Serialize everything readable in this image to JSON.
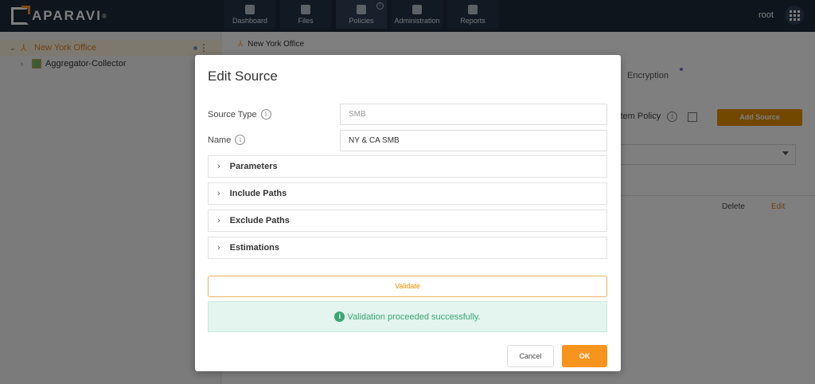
{
  "app": {
    "logo_text": "APARAVI",
    "logo_mark": "®"
  },
  "nav": {
    "items": [
      {
        "label": "Dashboard",
        "icon": "dashboard-icon"
      },
      {
        "label": "Files",
        "icon": "files-icon"
      },
      {
        "label": "Policies",
        "icon": "policies-icon",
        "active": true,
        "badge": "i"
      },
      {
        "label": "Administration",
        "icon": "administration-icon"
      },
      {
        "label": "Reports",
        "icon": "reports-icon"
      }
    ],
    "user": "root"
  },
  "sidebar": {
    "items": [
      {
        "label": "New York Office",
        "caret": "⌄",
        "selected": true,
        "icon": "organization-icon",
        "menu": "⋮"
      },
      {
        "label": "Aggregator-Collector",
        "caret": "›",
        "icon": "aggregator-icon"
      }
    ]
  },
  "main": {
    "breadcrumb": "New York Office",
    "tab_encryption": "Encryption",
    "policy_label": "stem Policy",
    "info_glyph": "i",
    "add_source_label": "Add Source",
    "delete_label": "Delete",
    "edit_label": "Edit"
  },
  "modal": {
    "title": "Edit Source",
    "source_type_label": "Source Type",
    "source_type_value": "SMB",
    "name_label": "Name",
    "name_value": "NY & CA SMB",
    "info_glyph": "i",
    "sections": [
      {
        "label": "Parameters",
        "chevron": "›"
      },
      {
        "label": "Include Paths",
        "chevron": "›"
      },
      {
        "label": "Exclude Paths",
        "chevron": "›"
      },
      {
        "label": "Estimations",
        "chevron": "›"
      }
    ],
    "validate_label": "Validate",
    "alert_icon": "i",
    "alert_text": "Validation proceeded successfully.",
    "cancel_label": "Cancel",
    "ok_label": "OK"
  },
  "colors": {
    "accent": "#f7941d",
    "topbar": "#1c2a3a",
    "success": "#3aa574"
  }
}
